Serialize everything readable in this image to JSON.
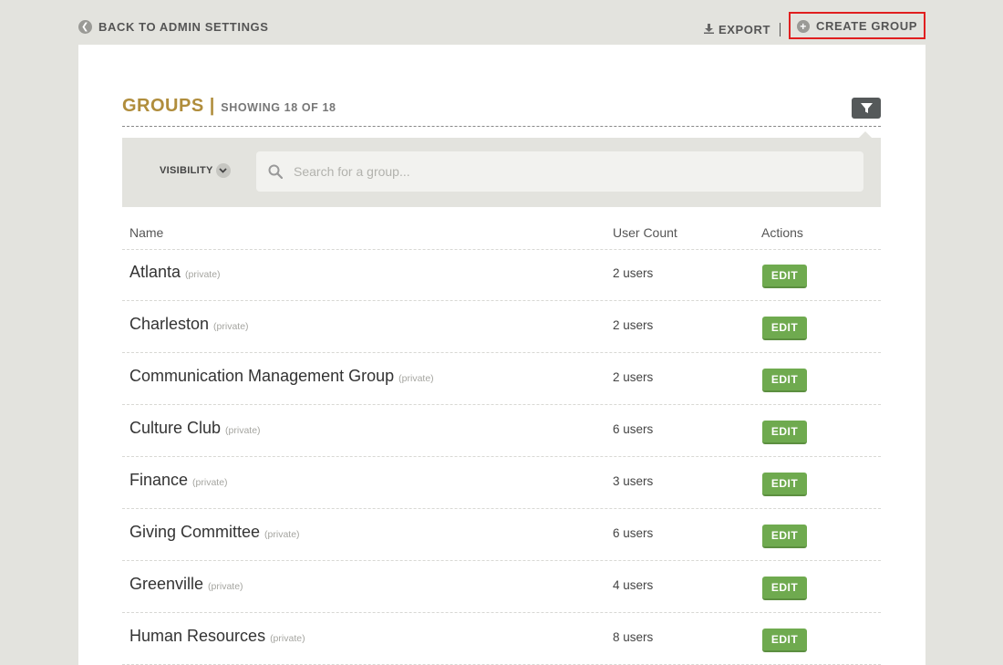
{
  "topbar": {
    "back_label": "BACK TO ADMIN SETTINGS",
    "export_label": "EXPORT",
    "create_group_label": "CREATE GROUP"
  },
  "heading": {
    "title": "GROUPS",
    "separator": "|",
    "showing": "SHOWING 18 OF 18"
  },
  "filters": {
    "visibility_label": "VISIBILITY",
    "search_placeholder": "Search for a group..."
  },
  "table": {
    "columns": [
      "Name",
      "User Count",
      "Actions"
    ],
    "rows": [
      {
        "name": "Atlanta",
        "visibility": "(private)",
        "count": "2 users",
        "action": "EDIT"
      },
      {
        "name": "Charleston",
        "visibility": "(private)",
        "count": "2 users",
        "action": "EDIT"
      },
      {
        "name": "Communication Management Group",
        "visibility": "(private)",
        "count": "2 users",
        "action": "EDIT"
      },
      {
        "name": "Culture Club",
        "visibility": "(private)",
        "count": "6 users",
        "action": "EDIT"
      },
      {
        "name": "Finance",
        "visibility": "(private)",
        "count": "3 users",
        "action": "EDIT"
      },
      {
        "name": "Giving Committee",
        "visibility": "(private)",
        "count": "6 users",
        "action": "EDIT"
      },
      {
        "name": "Greenville",
        "visibility": "(private)",
        "count": "4 users",
        "action": "EDIT"
      },
      {
        "name": "Human Resources",
        "visibility": "(private)",
        "count": "8 users",
        "action": "EDIT"
      }
    ]
  },
  "colors": {
    "accent_gold": "#b08d3c",
    "edit_green": "#6faa4f",
    "highlight_red": "#e01f1f",
    "background": "#e3e3de"
  },
  "icons": {
    "back": "chevron-left-icon",
    "export": "download-icon",
    "create": "plus-icon",
    "filter": "funnel-icon",
    "visibility": "chevron-down-icon",
    "search": "search-icon"
  }
}
